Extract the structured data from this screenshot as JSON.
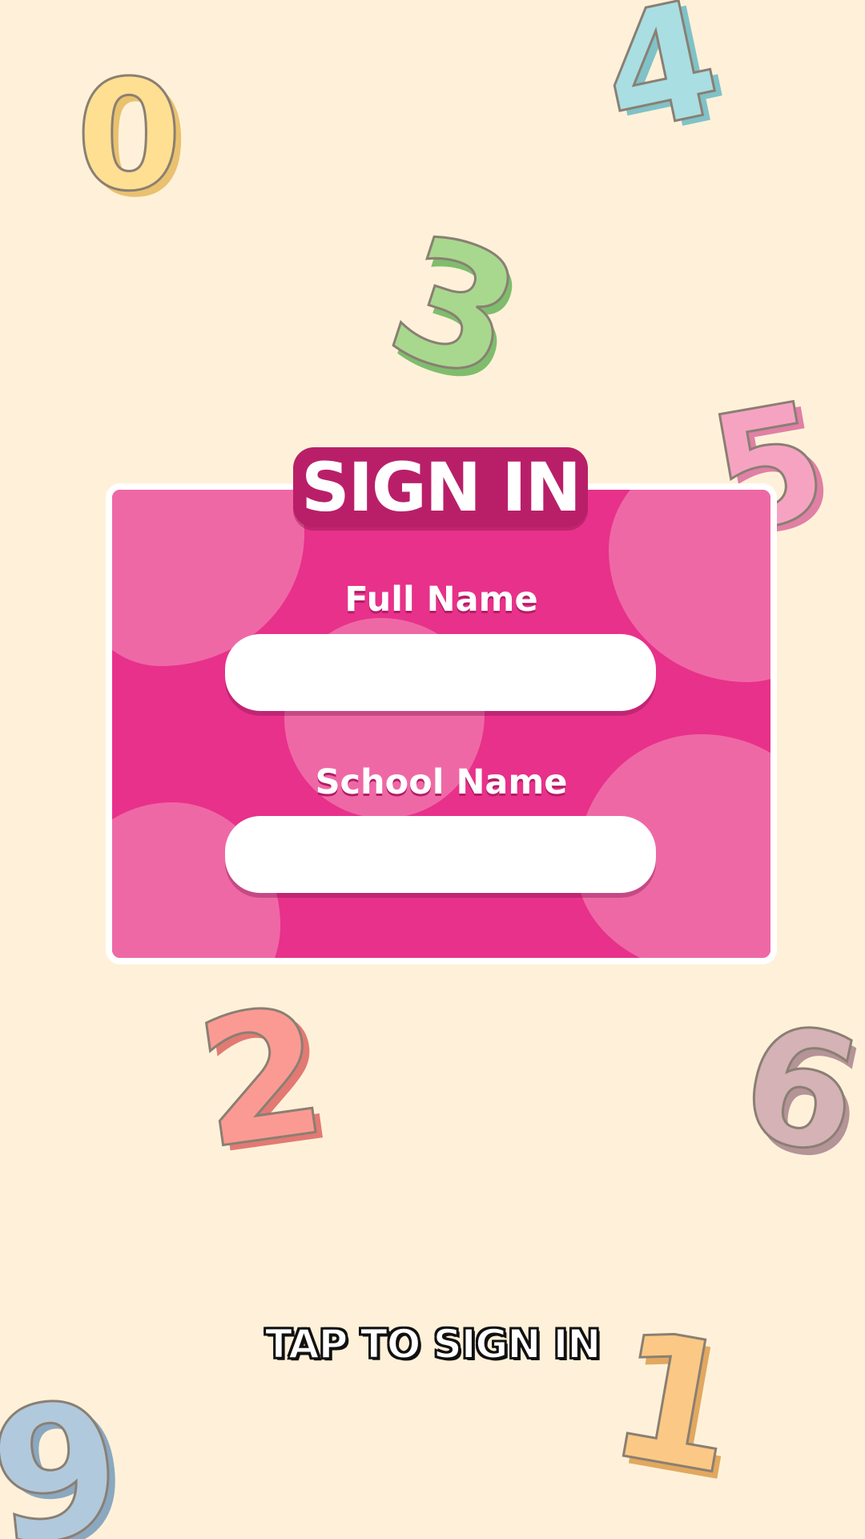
{
  "title": "SIGN IN",
  "form": {
    "full_name_label": "Full Name",
    "full_name_value": "",
    "school_name_label": "School Name",
    "school_name_value": ""
  },
  "cta_label": "TAP TO SIGN IN",
  "decor_digits": [
    "0",
    "4",
    "3",
    "5",
    "2",
    "6",
    "9",
    "1"
  ],
  "colors": {
    "background": "#fff1d9",
    "card": "#e8318a",
    "card_blob": "#ef68a6",
    "title_badge": "#b91f69",
    "input": "#ffffff"
  }
}
